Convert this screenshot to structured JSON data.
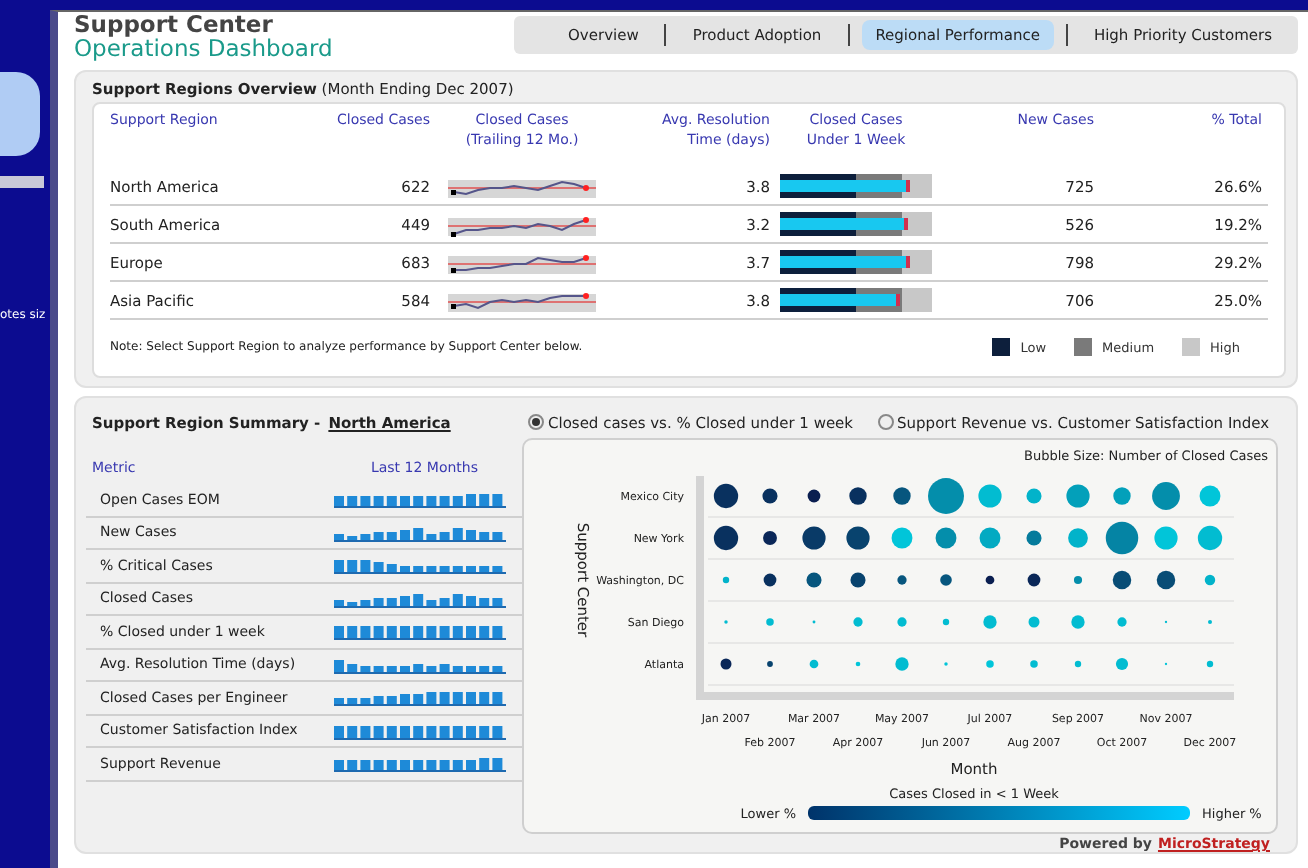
{
  "backdrop": {
    "text": "otes siz"
  },
  "header": {
    "title": "Support Center",
    "subtitle": "Operations Dashboard"
  },
  "tabs": [
    {
      "label": "Overview",
      "selected": false
    },
    {
      "label": "Product Adoption",
      "selected": false
    },
    {
      "label": "Regional Performance",
      "selected": true
    },
    {
      "label": "High Priority Customers",
      "selected": false
    }
  ],
  "overview": {
    "title": "**Support Regions Overview** (Month Ending Dec 2007)",
    "columns": [
      "Support Region",
      "Closed Cases",
      "Closed Cases\n(Trailing 12 Mo.)",
      "Avg. Resolution\nTime (days)",
      "Closed Cases\nUnder 1 Week",
      "New Cases",
      "% Total"
    ],
    "rows": [
      {
        "region": "North America",
        "closed": "622",
        "avg": "3.8",
        "level": 0.85,
        "new": "725",
        "pct": "26.6%"
      },
      {
        "region": "South America",
        "closed": "449",
        "avg": "3.2",
        "level": 0.84,
        "new": "526",
        "pct": "19.2%"
      },
      {
        "region": "Europe",
        "closed": "683",
        "avg": "3.7",
        "level": 0.85,
        "new": "798",
        "pct": "29.2%"
      },
      {
        "region": "Asia Pacific",
        "closed": "584",
        "avg": "3.8",
        "level": 0.79,
        "new": "706",
        "pct": "25.0%"
      }
    ],
    "note": "Note: Select Support Region to analyze performance by Support Center below.",
    "legend": [
      {
        "label": "Low",
        "color": "#0d1f3c"
      },
      {
        "label": "Medium",
        "color": "#7a7a7a"
      },
      {
        "label": "High",
        "color": "#c8c8c8"
      }
    ]
  },
  "summary": {
    "title": "Support Region Summary -",
    "region": "North America",
    "columns": [
      "Metric",
      "Last 12 Months"
    ],
    "metrics": [
      "Open Cases EOM",
      "New Cases",
      "% Critical Cases",
      "Closed Cases",
      "% Closed under 1 week",
      "Avg. Resolution Time (days)",
      "Closed Cases per Engineer",
      "Customer Satisfaction Index",
      "Support Revenue"
    ]
  },
  "view_options": [
    {
      "label": "Closed cases vs. % Closed under 1 week",
      "selected": true
    },
    {
      "label": "Support Revenue vs. Customer Satisfaction Index",
      "selected": false
    }
  ],
  "bubble_chart": {
    "note": "Bubble Size: Number of Closed Cases",
    "y_title": "Support Center",
    "centers": [
      "Mexico City",
      "New York",
      "Washington, DC",
      "San Diego",
      "Atlanta"
    ],
    "months": [
      "Jan 2007",
      "Feb 2007",
      "Mar 2007",
      "Apr 2007",
      "May 2007",
      "Jun 2007",
      "Jul 2007",
      "Aug 2007",
      "Sep 2007",
      "Oct 2007",
      "Nov 2007",
      "Dec 2007"
    ],
    "x_title": "Month",
    "color_legend": {
      "title": "Cases Closed in < 1 Week",
      "low": "Lower %",
      "high": "Higher %"
    }
  },
  "footer": {
    "text": "Powered by",
    "link": "MicroStrategy"
  }
}
